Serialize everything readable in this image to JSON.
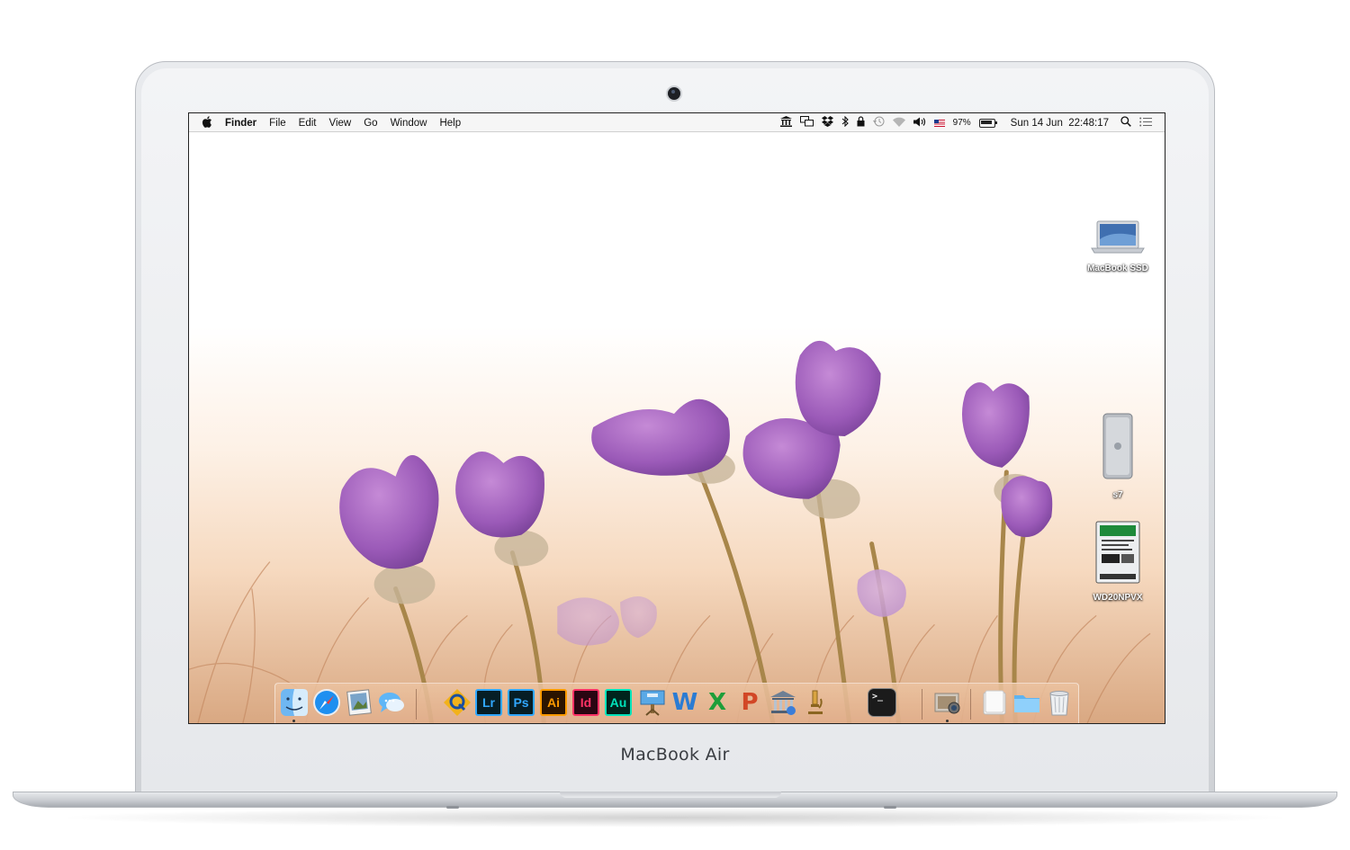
{
  "device": {
    "brand_label": "MacBook Air"
  },
  "menubar": {
    "apple": "",
    "app_name": "Finder",
    "menus": [
      "File",
      "Edit",
      "View",
      "Go",
      "Window",
      "Help"
    ],
    "battery_percent": "97%",
    "datetime": "Sun 14 Jun  22:48:17",
    "status_icons": [
      "bank-icon",
      "display-icon",
      "dropbox-icon",
      "bluetooth-icon",
      "lock-icon",
      "time-machine-icon",
      "wifi-icon",
      "volume-icon",
      "us-flag-icon",
      "battery-icon",
      "spotlight-icon",
      "notification-center-icon"
    ]
  },
  "desktop": {
    "icons": [
      {
        "label": "MacBook SSD",
        "type": "laptop-drive-icon"
      },
      {
        "label": "s7",
        "type": "external-drive-icon"
      },
      {
        "label": "WD20NPVX",
        "type": "hard-disk-icon"
      }
    ]
  },
  "dock": {
    "apps": [
      {
        "name": "Finder",
        "icon": "finder-icon",
        "running": true
      },
      {
        "name": "Safari",
        "icon": "safari-icon",
        "running": false
      },
      {
        "name": "Preview",
        "icon": "preview-icon",
        "running": false
      },
      {
        "name": "Messages",
        "icon": "messages-icon",
        "running": false
      },
      {
        "name": "Quicken",
        "icon": "q-app-icon",
        "running": false
      },
      {
        "name": "Lr",
        "icon": "lightroom-icon",
        "running": false
      },
      {
        "name": "Ps",
        "icon": "photoshop-icon",
        "running": false
      },
      {
        "name": "Ai",
        "icon": "illustrator-icon",
        "running": false
      },
      {
        "name": "Id",
        "icon": "indesign-icon",
        "running": false
      },
      {
        "name": "Au",
        "icon": "audition-icon",
        "running": false
      },
      {
        "name": "Keynote",
        "icon": "keynote-icon",
        "running": false
      },
      {
        "name": "W",
        "icon": "word-icon",
        "running": false
      },
      {
        "name": "X",
        "icon": "excel-icon",
        "running": false
      },
      {
        "name": "P",
        "icon": "powerpoint-icon",
        "running": false
      },
      {
        "name": "Bank",
        "icon": "bank-app-icon",
        "running": false
      },
      {
        "name": "Microscope",
        "icon": "microscope-icon",
        "running": false
      },
      {
        "name": "Terminal",
        "icon": "terminal-icon",
        "running": false
      },
      {
        "name": "Image Capture",
        "icon": "image-capture-icon",
        "running": true
      },
      {
        "name": "Documents",
        "icon": "documents-stack-icon",
        "running": false
      },
      {
        "name": "Folder",
        "icon": "folder-icon",
        "running": false
      },
      {
        "name": "Trash",
        "icon": "trash-icon",
        "running": false
      }
    ],
    "terminal_prompt": ">_"
  },
  "colors": {
    "lr": "#31a8ff",
    "ps": "#31a8ff",
    "ai": "#ff9a00",
    "id": "#ff3366",
    "au": "#00e4bb",
    "word": "#2b7cd3",
    "excel": "#1e9e3a",
    "powerpoint": "#d24726"
  }
}
